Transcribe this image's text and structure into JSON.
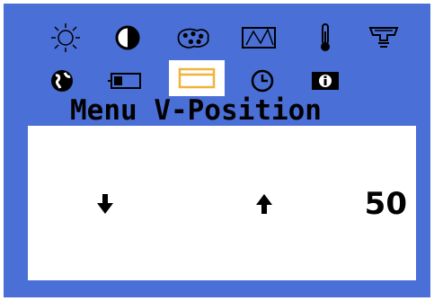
{
  "menu": {
    "title": "Menu V-Position",
    "selected_icon": "v-position-icon",
    "row1_icons": [
      "brightness-icon",
      "contrast-icon",
      "color-icon",
      "geometry-icon",
      "color-temperature-icon",
      "degauss-icon"
    ],
    "row2_icons": [
      "language-icon",
      "h-position-icon",
      "v-position-icon",
      "timer-icon",
      "information-icon"
    ]
  },
  "control": {
    "decrease_icon": "down-arrow-icon",
    "increase_icon": "up-arrow-icon",
    "value": "50"
  },
  "colors": {
    "background": "#4a6fd6",
    "panel": "#ffffff",
    "selected_icon": "#f0b43c",
    "icon": "#000000"
  }
}
